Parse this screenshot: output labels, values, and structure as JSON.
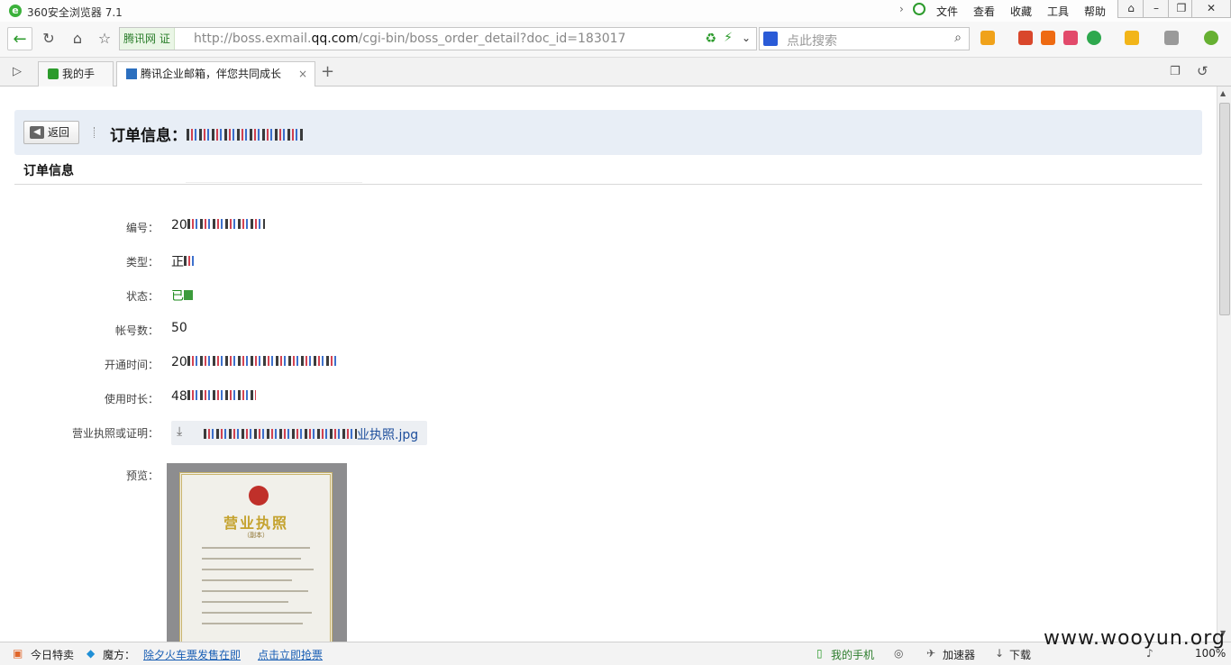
{
  "app": {
    "title": "360安全浏览器 7.1"
  },
  "menu": [
    "文件",
    "查看",
    "收藏",
    "工具",
    "帮助"
  ],
  "address": {
    "site_badge": "腾讯网 证",
    "url_prefix": "http://boss.exmail.",
    "url_domain": "qq.com",
    "url_suffix": "/cgi-bin/boss_order_detail?doc_id=183017"
  },
  "search": {
    "placeholder": "点此搜索"
  },
  "tabs": [
    {
      "label": "我的手机"
    },
    {
      "label": "腾讯企业邮箱，伴您共同成长"
    }
  ],
  "page": {
    "back_label": "返回",
    "title_prefix": "订单信息：",
    "section_title": "订单信息",
    "fields": {
      "number_label": "编号：",
      "number_value": "20",
      "type_label": "类型：",
      "type_value": "正",
      "status_label": "状态：",
      "status_value": "已",
      "accounts_label": "帐号数：",
      "accounts_value": "50",
      "open_time_label": "开通时间：",
      "open_time_value": "20",
      "duration_label": "使用时长：",
      "duration_value": "48",
      "license_label": "营业执照或证明：",
      "license_file": "业执照.jpg",
      "preview_label": "预览："
    },
    "preview": {
      "cert_title": "营业执照",
      "cert_sub": "（副本）"
    }
  },
  "statusbar": {
    "today_sale": "今日特卖",
    "magic": "魔方：",
    "promo1": "除夕火车票发售在即",
    "promo2": "点击立即抢票",
    "my_phone": "我的手机",
    "accelerator": "加速器",
    "download": "下载",
    "zoom": "100%"
  },
  "watermark": "www.wooyun.org",
  "colors": {
    "accent_green": "#2c9b2c",
    "link_blue": "#1a5fb4",
    "header_bg": "#e8eef6"
  }
}
